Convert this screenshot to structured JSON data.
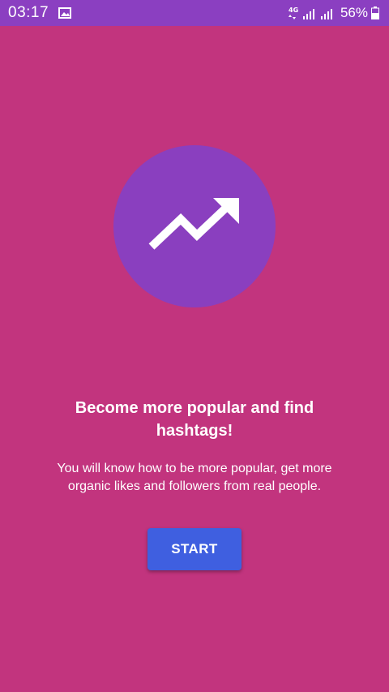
{
  "status_bar": {
    "time": "03:17",
    "network_type": "4G",
    "battery_percent": "56%",
    "icons": [
      "gallery-icon",
      "network-4g-icon",
      "signal-icon",
      "signal-icon",
      "battery-icon"
    ]
  },
  "colors": {
    "background": "#c2347e",
    "status_bar": "#8b3fc1",
    "circle": "#8a3fbf",
    "button": "#3f5fe0",
    "text": "#ffffff"
  },
  "hero": {
    "icon": "trending-up-icon"
  },
  "content": {
    "headline_line1": "Become more popular and find",
    "headline_line2": "hashtags!",
    "description_line1": "You will know how to be more popular, get more",
    "description_line2": "organic likes and followers from real people."
  },
  "actions": {
    "start_label": "START"
  }
}
